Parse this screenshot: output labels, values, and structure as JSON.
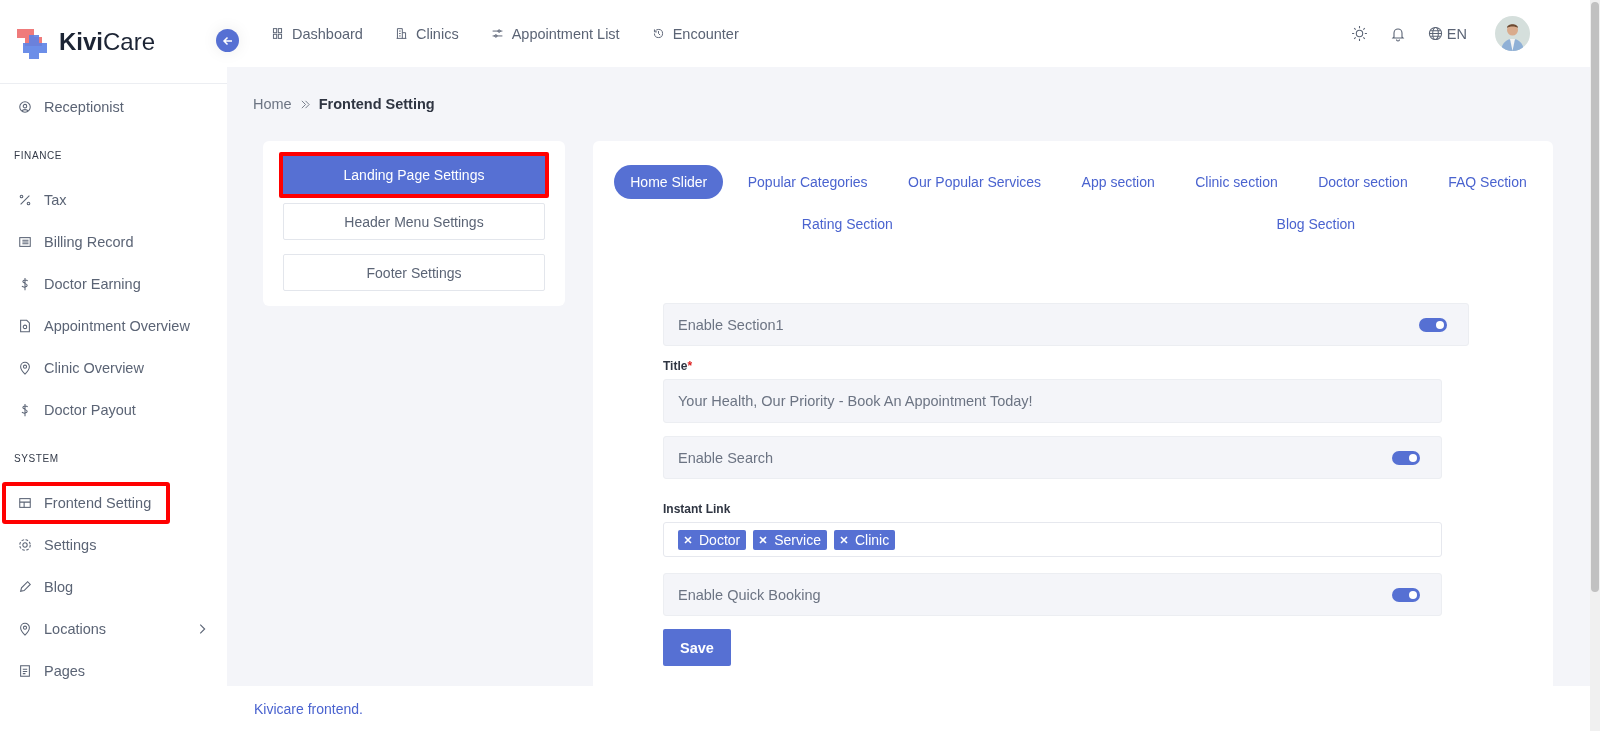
{
  "brand": {
    "name_bold": "Kivi",
    "name_rest": "Care"
  },
  "sidebar": {
    "items": [
      {
        "kind": "item",
        "label": "Receptionist",
        "annotated": false,
        "expandable": false
      },
      {
        "kind": "heading",
        "label": "FINANCE"
      },
      {
        "kind": "item",
        "label": "Tax",
        "annotated": false,
        "expandable": false
      },
      {
        "kind": "item",
        "label": "Billing Record",
        "annotated": false,
        "expandable": false
      },
      {
        "kind": "item",
        "label": "Doctor Earning",
        "annotated": false,
        "expandable": false
      },
      {
        "kind": "item",
        "label": "Appointment Overview",
        "annotated": false,
        "expandable": false
      },
      {
        "kind": "item",
        "label": "Clinic Overview",
        "annotated": false,
        "expandable": false
      },
      {
        "kind": "item",
        "label": "Doctor Payout",
        "annotated": false,
        "expandable": false
      },
      {
        "kind": "heading",
        "label": "SYSTEM"
      },
      {
        "kind": "item",
        "label": "Frontend Setting",
        "annotated": true,
        "expandable": false
      },
      {
        "kind": "item",
        "label": "Settings",
        "annotated": false,
        "expandable": false
      },
      {
        "kind": "item",
        "label": "Blog",
        "annotated": false,
        "expandable": false
      },
      {
        "kind": "item",
        "label": "Locations",
        "annotated": false,
        "expandable": true
      },
      {
        "kind": "item",
        "label": "Pages",
        "annotated": false,
        "expandable": false
      }
    ]
  },
  "topnav": [
    {
      "label": "Dashboard"
    },
    {
      "label": "Clinics"
    },
    {
      "label": "Appointment List"
    },
    {
      "label": "Encounter"
    }
  ],
  "language": "EN",
  "breadcrumb": {
    "home": "Home",
    "current": "Frontend Setting"
  },
  "settings_menu": [
    {
      "label": "Landing Page Settings",
      "selected": true,
      "annotated": true
    },
    {
      "label": "Header Menu Settings",
      "selected": false,
      "annotated": false
    },
    {
      "label": "Footer Settings",
      "selected": false,
      "annotated": false
    }
  ],
  "tabs": [
    {
      "label": "Home Slider",
      "selected": true
    },
    {
      "label": "Popular Categories",
      "selected": false
    },
    {
      "label": "Our Popular Services",
      "selected": false
    },
    {
      "label": "App section",
      "selected": false
    },
    {
      "label": "Clinic section",
      "selected": false
    },
    {
      "label": "Doctor section",
      "selected": false
    },
    {
      "label": "FAQ Section",
      "selected": false
    },
    {
      "label": "Rating Section",
      "selected": false
    },
    {
      "label": "Blog Section",
      "selected": false
    }
  ],
  "form": [
    {
      "kind": "toggle",
      "label": "Enable Section1",
      "on": true,
      "wide": true
    },
    {
      "kind": "text",
      "label": "Title",
      "required_mark": "*",
      "value": "Your Health, Our Priority - Book An Appointment Today!"
    },
    {
      "kind": "toggle",
      "label": "Enable Search",
      "on": true,
      "wide": false
    },
    {
      "kind": "tags",
      "label": "Instant Link",
      "tags": [
        "Doctor",
        "Service",
        "Clinic"
      ]
    },
    {
      "kind": "toggle",
      "label": "Enable Quick Booking",
      "on": true,
      "wide": false
    }
  ],
  "save_button": "Save",
  "footer": "Kivicare frontend."
}
